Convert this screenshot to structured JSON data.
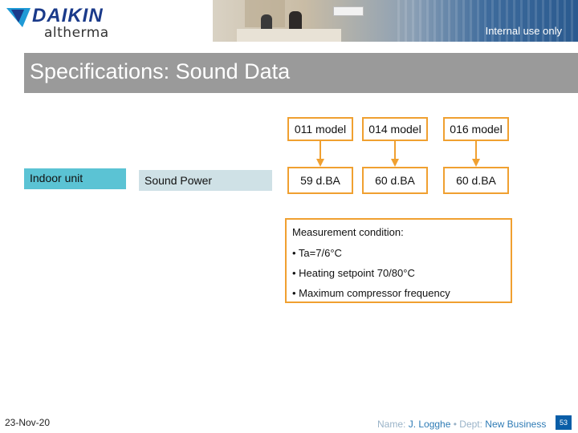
{
  "header": {
    "brand": "DAIKIN",
    "product": "altherma",
    "classification": "Internal use only"
  },
  "title": "Specifications: Sound Data",
  "row": {
    "category": "Indoor unit",
    "parameter": "Sound Power"
  },
  "models": [
    {
      "label": "011 model",
      "value": "59 d.BA"
    },
    {
      "label": "014 model",
      "value": "60 d.BA"
    },
    {
      "label": "016 model",
      "value": "60 d.BA"
    }
  ],
  "conditions": {
    "title": "Measurement condition:",
    "items": [
      "• Ta=7/6°C",
      "• Heating setpoint 70/80°C",
      "• Maximum compressor frequency"
    ]
  },
  "footer": {
    "date": "23-Nov-20",
    "name_label": "Name: ",
    "name_value": "J. Logghe",
    "separator": " • ",
    "dept_label": "Dept: ",
    "dept_value": "New Business",
    "page": "53"
  },
  "colors": {
    "accent_orange": "#f0a030",
    "title_bar": "#9a9a9a",
    "indoor_label_bg": "#5bc3d4",
    "param_label_bg": "#cfe1e6",
    "brand_blue": "#1a3a8a",
    "page_badge": "#0a5ea8"
  }
}
